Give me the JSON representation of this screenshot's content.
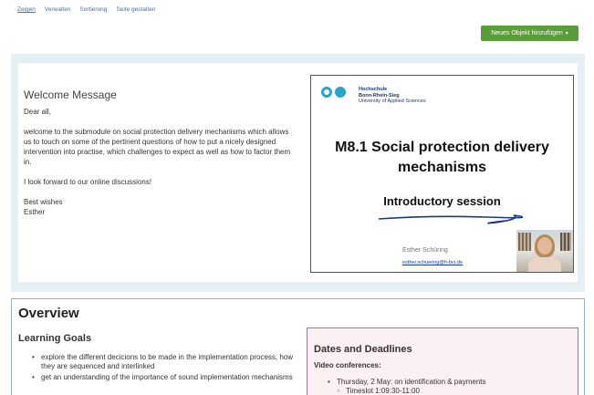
{
  "tabs": [
    {
      "label": "Zeigen",
      "active": true
    },
    {
      "label": "Verwalten",
      "active": false
    },
    {
      "label": "Sortierung",
      "active": false
    },
    {
      "label": "Seite gestalten",
      "active": false
    }
  ],
  "add_button": {
    "label": "Neues Objekt hinzufügen",
    "caret": "▾",
    "color": "#5a9b3a"
  },
  "welcome": {
    "title": "Welcome Message",
    "greeting": "Dear all,",
    "paragraph": "welcome to the submodule on social protection delivery mechanisms which allows us to touch on some of the pertinent questions of how to put a nicely designed intervention into practise, which challenges to expect as well as how to factor them in.",
    "closing_line": "I look forward to our online discussions!",
    "signoff": "Best wishes",
    "name": "Esther"
  },
  "slide": {
    "logo_line1": "Hochschule",
    "logo_line2": "Bonn-Rhein-Sieg",
    "logo_line3": "University of Applied Sciences",
    "title_line1": "M8.1 Social protection delivery",
    "title_line2": "mechanisms",
    "subtitle": "Introductory session",
    "presenter": "Esther Schüring",
    "email": "esther.schuering@h-brs.de",
    "accent": "#2aa4c8"
  },
  "overview": {
    "title": "Overview",
    "learning_goals_title": "Learning Goals",
    "learning_goals": [
      "explore the different decicions to be made in the implementation process, how they are sequenced and interlinked",
      "get an understanding of the importance of sound implementation mechanisms"
    ]
  },
  "dates": {
    "title": "Dates and Deadlines",
    "subtitle": "Video conferences:",
    "item1": "Thursday, 2 May: on identification & payments",
    "item1_sub": "Timeslot 1:09:30-11:00"
  }
}
